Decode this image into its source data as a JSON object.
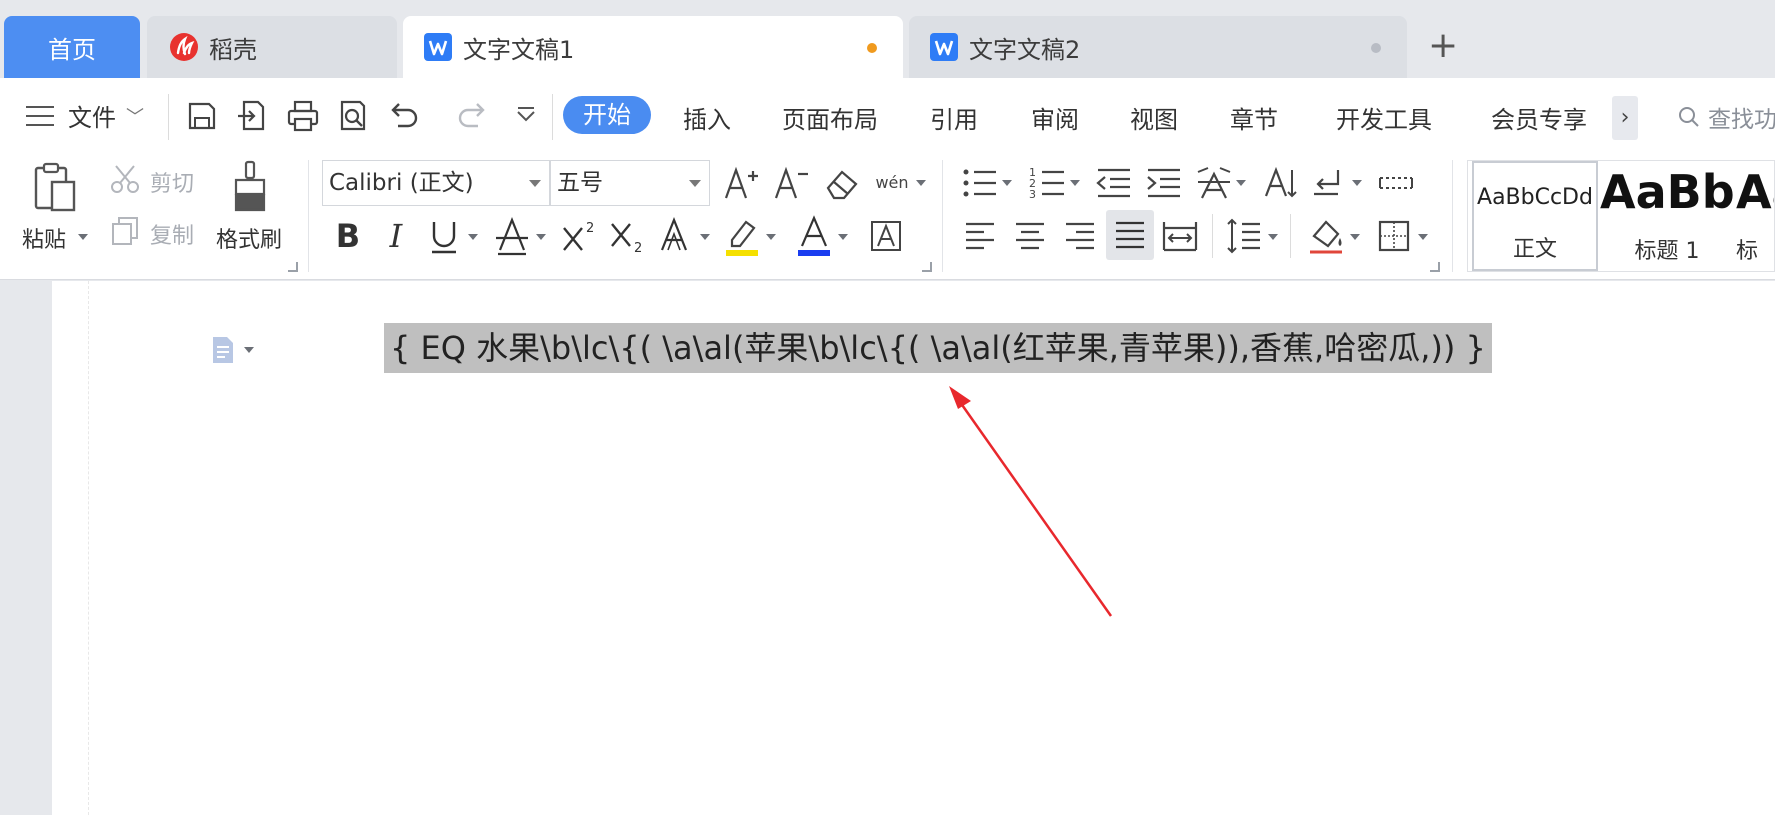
{
  "tabs": {
    "home": "首页",
    "daoke": "稻壳",
    "doc1": "文字文稿1",
    "doc2": "文字文稿2",
    "add": "+"
  },
  "menu": {
    "file": "文件",
    "tabs": [
      "开始",
      "插入",
      "页面布局",
      "引用",
      "审阅",
      "视图",
      "章节",
      "开发工具",
      "会员专享"
    ],
    "active_tab": "开始",
    "more": "›",
    "search_cmd": "查找功"
  },
  "ribbon": {
    "paste": "粘贴",
    "cut": "剪切",
    "copy": "复制",
    "format_painter": "格式刷",
    "font_name": "Calibri (正文)",
    "font_size": "五号",
    "pinyin_glyph": "wén",
    "styles": [
      {
        "preview": "AaBbCcDd",
        "name": "正文"
      },
      {
        "preview": "AaBb",
        "name": "标题 1"
      },
      {
        "preview": "Aa",
        "name": "标"
      }
    ]
  },
  "document": {
    "field_code": "{  EQ  水果\\b\\lc\\{( \\a\\al(苹果\\b\\lc\\{( \\a\\al(红苹果,青苹果)),香蕉,哈密瓜,))  }"
  },
  "colors": {
    "accent": "#4a8cf1",
    "home_tab": "#4d8ef2",
    "unsaved_dot": "#f09a1e",
    "highlight": "#f5e000",
    "font_color": "#1a3df0",
    "field_shading": "#bfbfbf",
    "annotation_arrow": "#e8282d"
  }
}
